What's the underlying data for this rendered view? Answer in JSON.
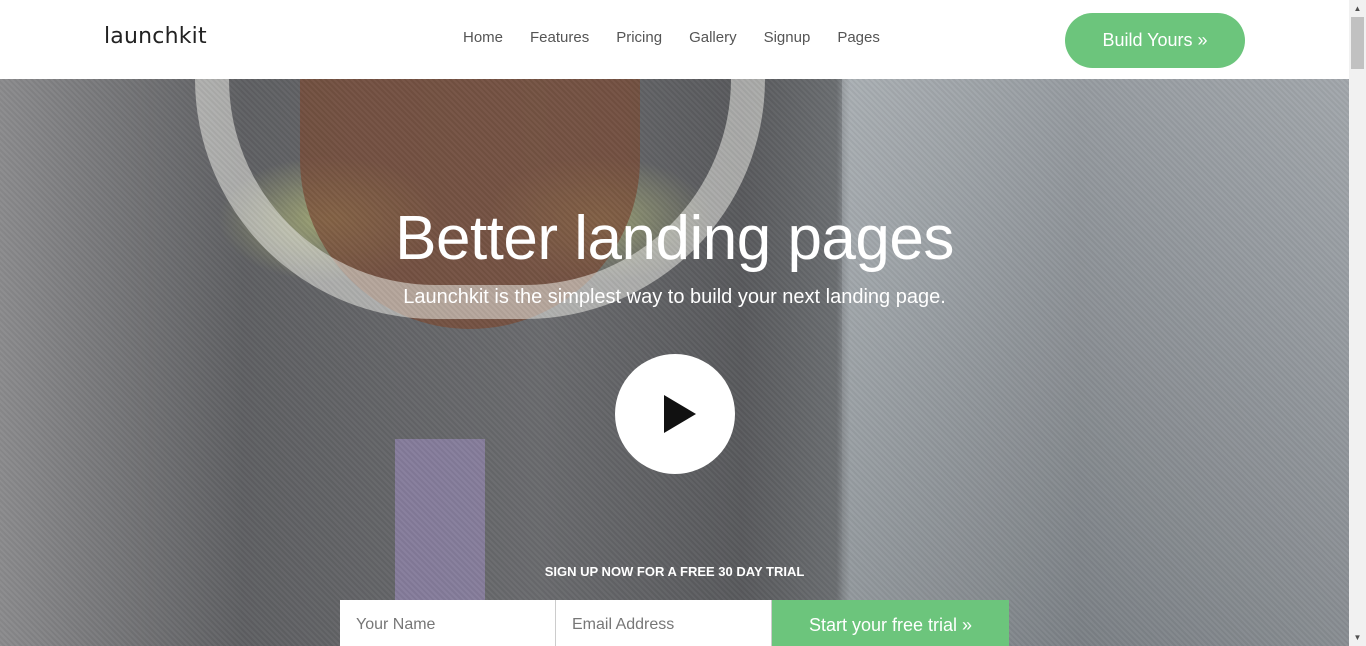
{
  "navbar": {
    "logo": "launchkit",
    "links": [
      "Home",
      "Features",
      "Pricing",
      "Gallery",
      "Signup",
      "Pages"
    ],
    "cta_label": "Build Yours »"
  },
  "hero": {
    "title": "Better landing pages",
    "subtitle": "Launchkit is the simplest way to build your next landing page.",
    "play_icon": "play-icon",
    "trial_label": "SIGN UP NOW FOR A FREE 30 DAY TRIAL",
    "form": {
      "name_placeholder": "Your Name",
      "email_placeholder": "Email Address",
      "submit_label": "Start your free trial »"
    }
  },
  "colors": {
    "accent": "#6cc57c",
    "nav_text": "#555555",
    "hero_text": "#ffffff"
  }
}
